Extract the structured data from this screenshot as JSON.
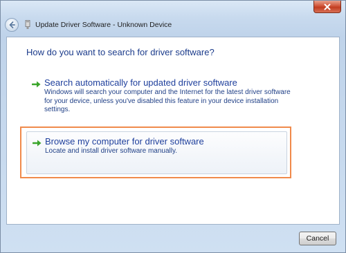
{
  "window": {
    "title": "Update Driver Software - Unknown Device"
  },
  "icons": {
    "back": "back-arrow-icon",
    "device": "device-icon",
    "close": "close-icon",
    "option_arrow": "green-arrow-icon"
  },
  "main": {
    "heading": "How do you want to search for driver software?",
    "options": [
      {
        "title": "Search automatically for updated driver software",
        "description": "Windows will search your computer and the Internet for the latest driver software for your device, unless you've disabled this feature in your device installation settings."
      },
      {
        "title": "Browse my computer for driver software",
        "description": "Locate and install driver software manually."
      }
    ]
  },
  "footer": {
    "cancel_label": "Cancel"
  },
  "colors": {
    "highlight_frame": "#f08a4b",
    "link_blue": "#1e3f9c",
    "arrow_green": "#3aa52a"
  }
}
